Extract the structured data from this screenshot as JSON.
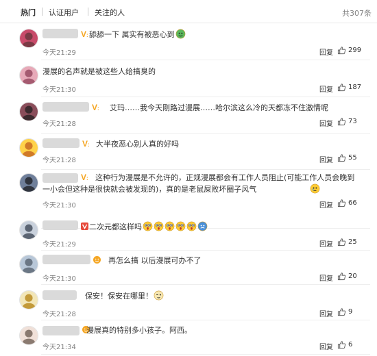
{
  "tabs": [
    {
      "label": "热门",
      "active": true
    },
    {
      "label": "认证用户",
      "active": false
    },
    {
      "label": "关注的人",
      "active": false
    }
  ],
  "total_label": "共307条",
  "reply_label": "回复",
  "colors": {
    "vip_orange": "#f5a623",
    "name_mask": "#dadada",
    "emoji_yellow": "#ffcc33",
    "emoji_green": "#5cb85c"
  },
  "comments": [
    {
      "text": "舔舔一下 属实有被恶心到",
      "emoji": [
        "green-face"
      ],
      "time": "今天21:29",
      "likes": "299",
      "vip": "v"
    },
    {
      "text": "漫展的名声就是被这些人给搞臭的",
      "emoji": [],
      "time": "今天21:30",
      "likes": "187",
      "vip": "none"
    },
    {
      "text": "艾玛……我今天刚路过漫展……哈尔滨这么冷的天都冻不住激情呢",
      "emoji": [],
      "time": "今天21:28",
      "likes": "73",
      "vip": "v"
    },
    {
      "text": "大半夜恶心别人真的好吗",
      "emoji": [],
      "time": "今天21:28",
      "likes": "55",
      "vip": "v"
    },
    {
      "text": "这种行为漫展是不允许的，正规漫展都会有工作人员阻止(可能工作人员会晚到一小会但这种是很快就会被发现的)，真的是老鼠屎败坏圈子风气",
      "emoji": [
        "crying-face"
      ],
      "time": "今天21:30",
      "likes": "66",
      "vip": "v"
    },
    {
      "text": "二次元都这样吗",
      "emoji": [
        "shocked-face",
        "shocked-face",
        "shocked-face",
        "shocked-face",
        "shocked-face",
        "blue-face"
      ],
      "time": "今天21:29",
      "likes": "25",
      "vip": "red"
    },
    {
      "text": "再怎么搞 以后漫展可办不了",
      "emoji": [],
      "time": "今天21:30",
      "likes": "20",
      "vip": "face"
    },
    {
      "text": "保安！保安在哪里！",
      "emoji": [
        "wink-face"
      ],
      "time": "今天21:28",
      "likes": "9",
      "vip": "none"
    },
    {
      "text": "漫展真的特别多小孩子。阿西。",
      "emoji": [],
      "time": "今天21:34",
      "likes": "6",
      "vip": "face"
    }
  ]
}
